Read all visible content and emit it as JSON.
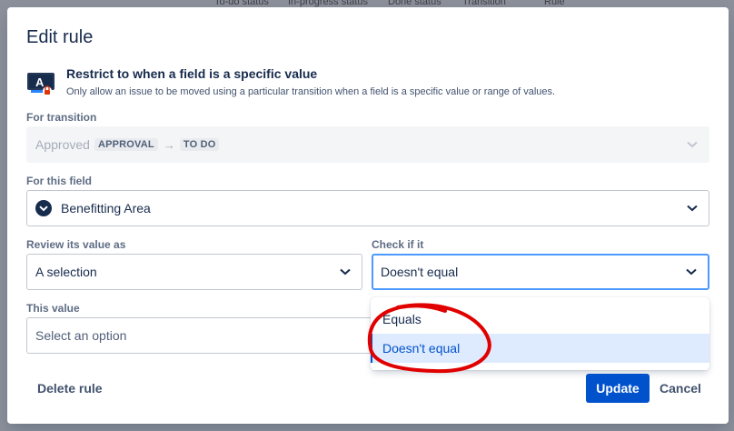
{
  "background": {
    "headers": [
      "To-do status",
      "In-progress status",
      "Done status",
      "Transition",
      "Rule"
    ]
  },
  "modal": {
    "title": "Edit rule",
    "rule": {
      "title": "Restrict to when a field is a specific value",
      "description": "Only allow an issue to be moved using a particular transition when a field is a specific value or range of values.",
      "icon": "field-value-restriction-icon"
    },
    "transition": {
      "label": "For transition",
      "name": "Approved",
      "from_status": "APPROVAL",
      "arrow": "→",
      "to_status": "TO DO"
    },
    "field": {
      "label": "For this field",
      "value": "Benefitting Area",
      "icon": "chevron-circle-icon"
    },
    "review": {
      "label": "Review its value as",
      "value": "A selection"
    },
    "check": {
      "label": "Check if it",
      "value": "Doesn't equal",
      "options": [
        "Equals",
        "Doesn't equal"
      ],
      "selected_index": 1
    },
    "this_value": {
      "label": "This value",
      "placeholder": "Select an option"
    },
    "footer": {
      "delete_label": "Delete rule",
      "update_label": "Update",
      "cancel_label": "Cancel"
    }
  },
  "colors": {
    "primary": "#0052cc",
    "focus_border": "#4c9aff",
    "selected_bg": "#deebff",
    "annotation": "#e00000"
  }
}
